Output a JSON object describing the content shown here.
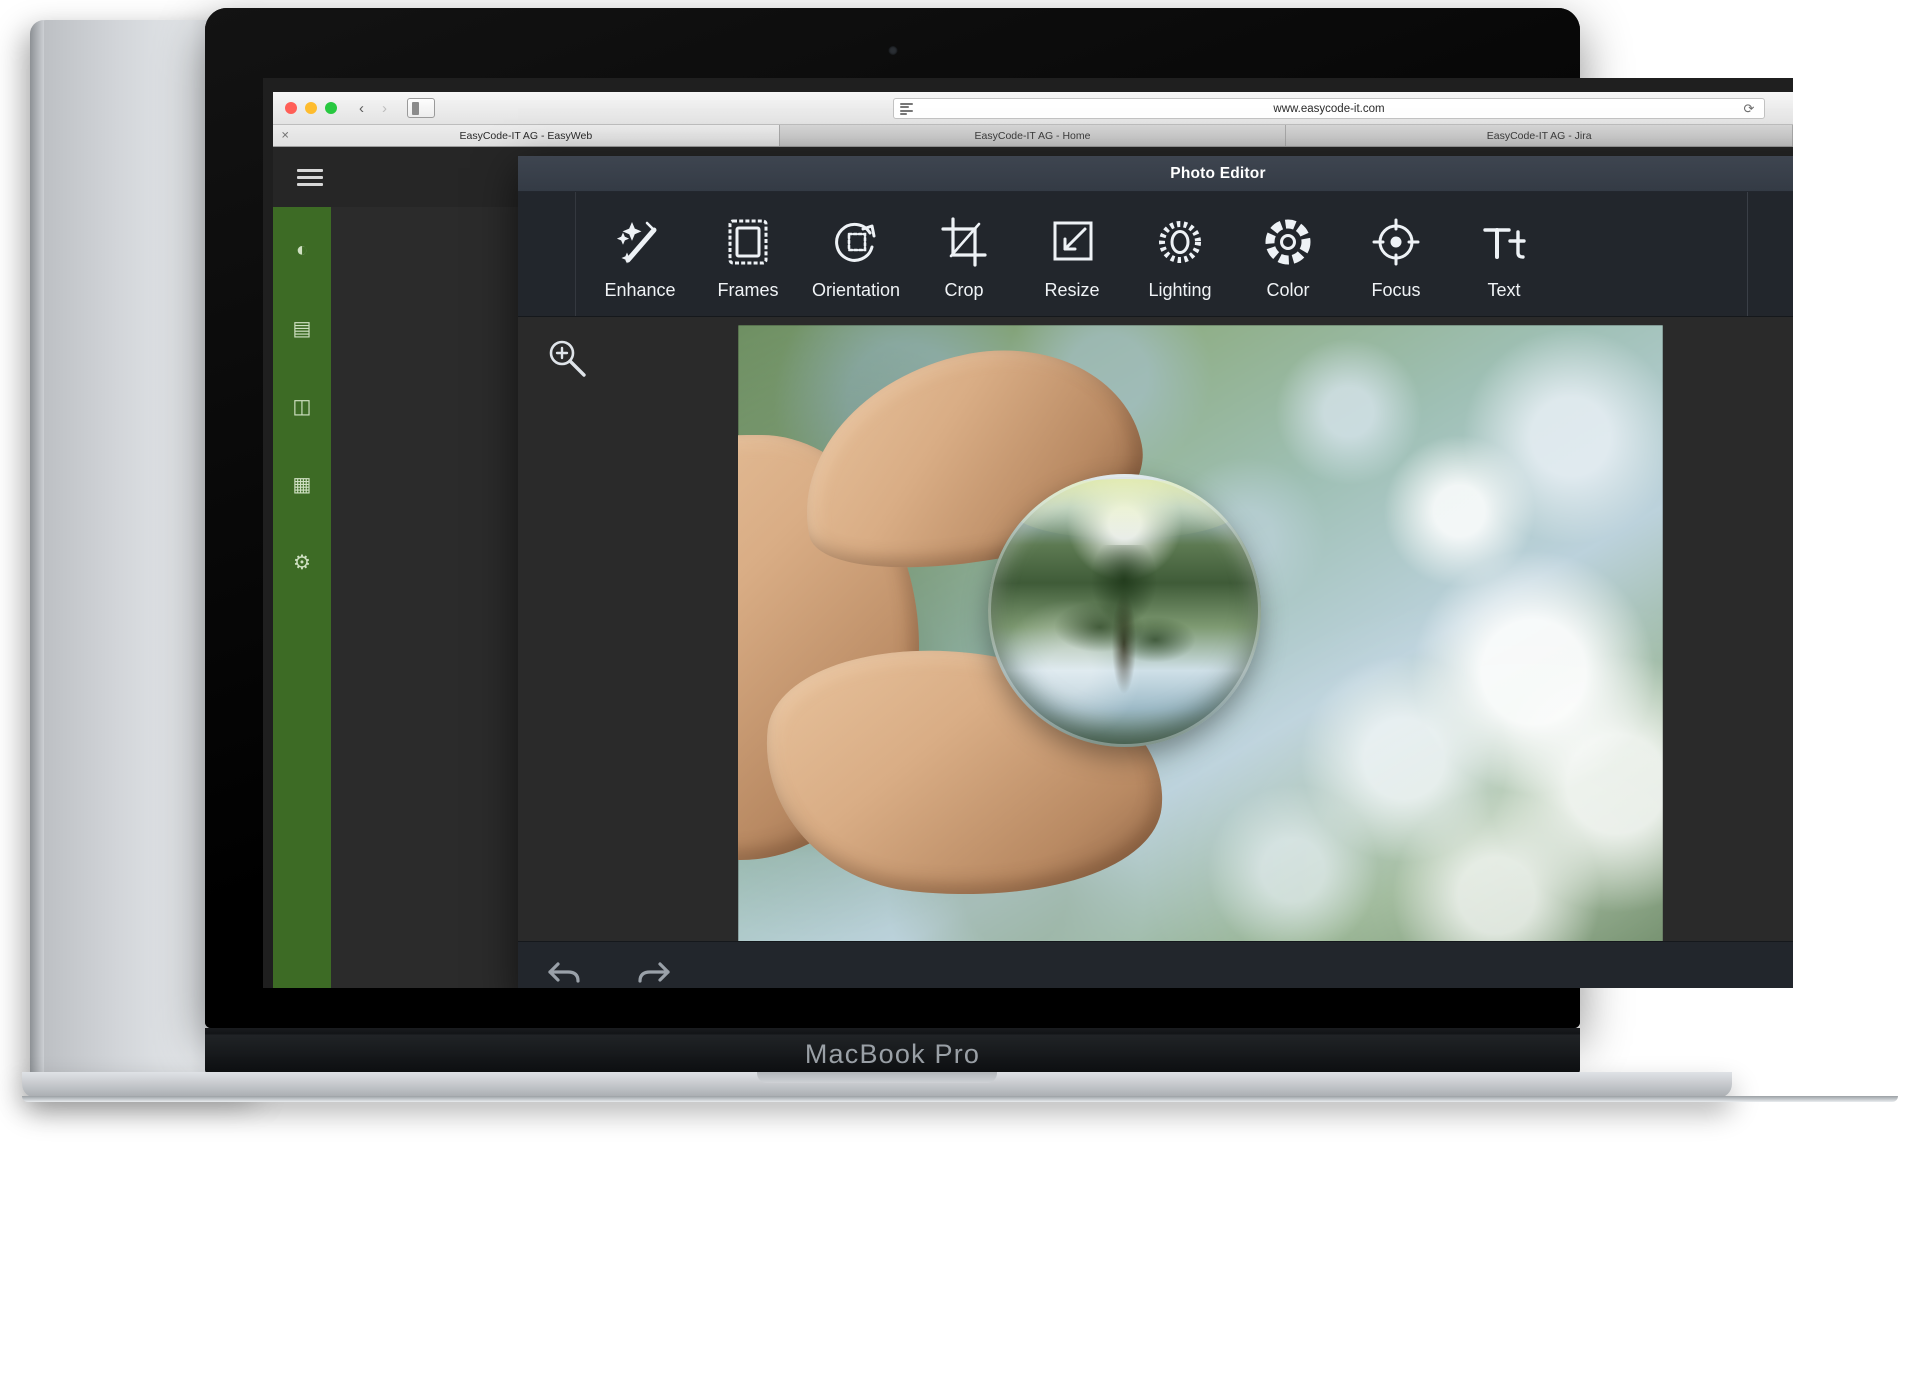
{
  "device": {
    "label": "MacBook Pro"
  },
  "browser": {
    "url": "www.easycode-it.com",
    "icons": {
      "back": "‹",
      "forward": "›",
      "reload": "⟳",
      "sidebar": "sidebar-icon",
      "reader": "reader-icon",
      "tab_close": "✕"
    },
    "tabs": [
      {
        "label": "EasyCode-IT AG - EasyWeb",
        "active": true
      },
      {
        "label": "EasyCode-IT AG - Home",
        "active": false
      },
      {
        "label": "EasyCode-IT AG - Jira",
        "active": false
      }
    ]
  },
  "editor": {
    "title": "Photo Editor",
    "tools": [
      {
        "label": "Enhance",
        "icon": "magic-wand-icon"
      },
      {
        "label": "Frames",
        "icon": "frame-icon"
      },
      {
        "label": "Orientation",
        "icon": "rotate-icon"
      },
      {
        "label": "Crop",
        "icon": "crop-icon"
      },
      {
        "label": "Resize",
        "icon": "resize-icon"
      },
      {
        "label": "Lighting",
        "icon": "sun-icon"
      },
      {
        "label": "Color",
        "icon": "color-wheel-icon"
      },
      {
        "label": "Focus",
        "icon": "focus-target-icon"
      },
      {
        "label": "Text",
        "icon": "text-icon"
      }
    ],
    "canvas": {
      "zoom_tool_icon": "zoom-in-icon",
      "image_description": "hand holding a glass lensball reflecting trees and sky"
    },
    "footer": {
      "undo_icon": "undo-arrow-icon",
      "redo_icon": "redo-arrow-icon"
    }
  },
  "page": {
    "menu_icon": "hamburger-menu-icon",
    "avatar": "user-avatar",
    "sidebar_items": [
      {
        "icon": "palette-icon"
      },
      {
        "icon": "document-icon"
      },
      {
        "icon": "folder-icon"
      },
      {
        "icon": "image-icon"
      },
      {
        "icon": "gear-icon"
      }
    ],
    "action_button": "primary-action-button"
  },
  "colors": {
    "accent_blue": "#2f80d8",
    "sidebar_green": "#3d6b25",
    "editor_bg": "#2a2a2a",
    "toolbar_bg": "#22262c",
    "titlebar_bg": "#3e4550"
  }
}
